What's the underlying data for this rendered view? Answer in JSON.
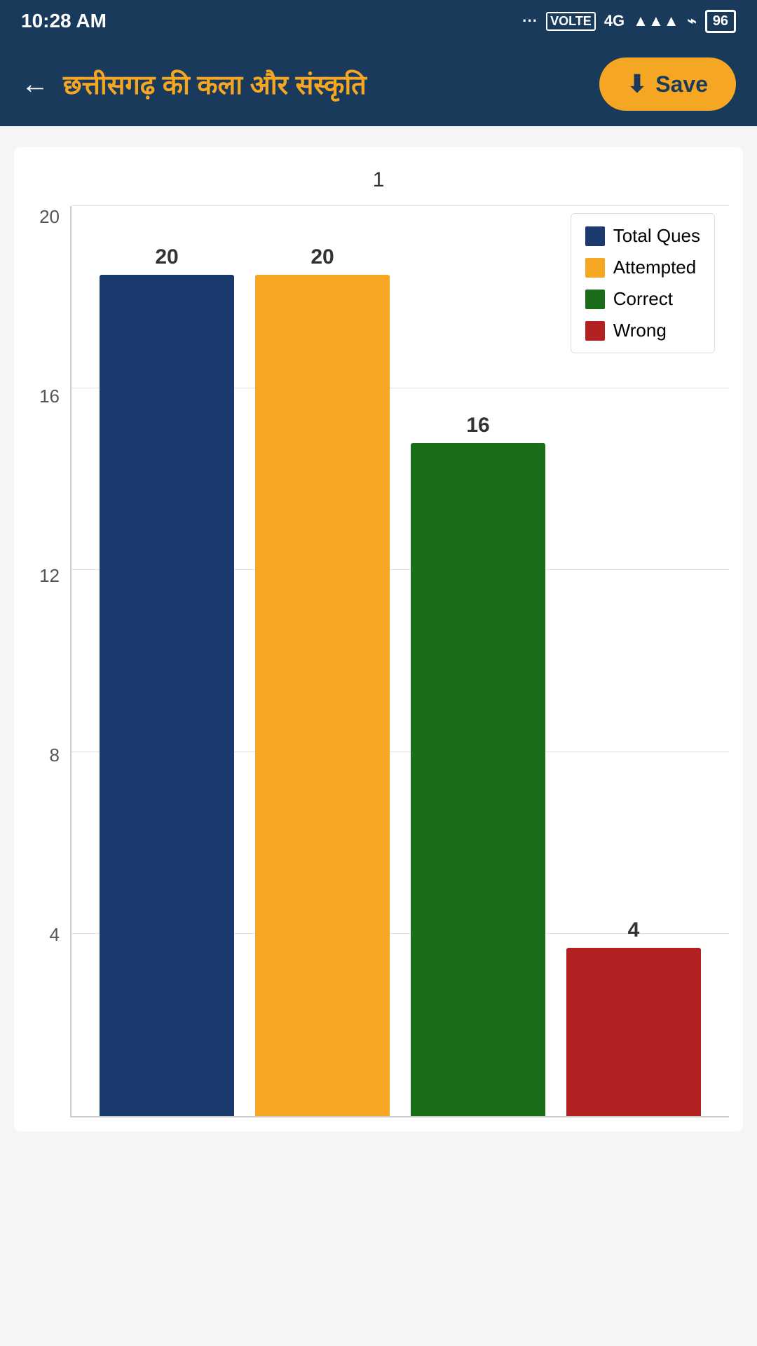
{
  "status_bar": {
    "time": "10:28 AM",
    "battery": "96"
  },
  "header": {
    "title": "छत्तीसगढ़ की कला और संस्कृति",
    "save_label": "Save",
    "back_label": "←"
  },
  "chart": {
    "subtitle": "1",
    "bars": [
      {
        "label": "Total Ques",
        "value": 20,
        "color": "#1a3a6e",
        "height_pct": 100
      },
      {
        "label": "Attempted",
        "value": 20,
        "color": "#f5a623",
        "height_pct": 100
      },
      {
        "label": "Correct",
        "value": 16,
        "color": "#1a6e1a",
        "height_pct": 80
      },
      {
        "label": "Wrong",
        "value": 4,
        "color": "#b22222",
        "height_pct": 20
      }
    ],
    "y_labels": [
      "20",
      "16",
      "12",
      "8",
      "4",
      ""
    ],
    "legend": [
      {
        "label": "Total Ques",
        "color": "#1a3a6e"
      },
      {
        "label": "Attempted",
        "color": "#f5a623"
      },
      {
        "label": "Correct",
        "color": "#1a6e1a"
      },
      {
        "label": "Wrong",
        "color": "#b22222"
      }
    ]
  }
}
